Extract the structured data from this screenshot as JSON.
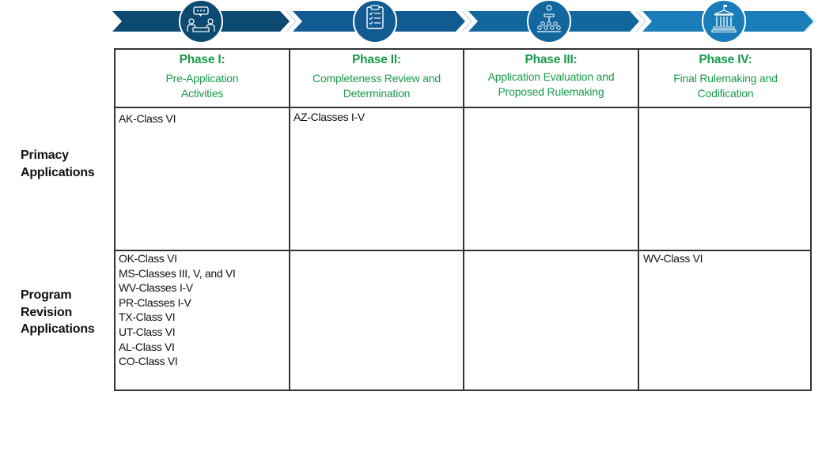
{
  "banner": {
    "colors": [
      "#0d4a72",
      "#115a92",
      "#13679f",
      "#1a7cb8"
    ],
    "icons": [
      "meeting-icon",
      "clipboard-checklist-icon",
      "presenter-audience-icon",
      "government-building-icon"
    ]
  },
  "phases": [
    {
      "label": "Phase I:",
      "description_lines": [
        "Pre-Application",
        "Activities"
      ]
    },
    {
      "label": "Phase II:",
      "description_lines": [
        "Completeness Review and",
        "Determination"
      ]
    },
    {
      "label": "Phase III:",
      "description_lines": [
        "Application Evaluation and",
        "Proposed Rulemaking"
      ]
    },
    {
      "label": "Phase IV:",
      "description_lines": [
        "Final Rulemaking and",
        "Codification"
      ]
    }
  ],
  "rows": [
    {
      "label_lines": [
        "Primacy",
        "Applications"
      ],
      "cells": [
        [
          "AK-Class VI"
        ],
        [
          "AZ-Classes I-V"
        ],
        [],
        []
      ]
    },
    {
      "label_lines": [
        "Program",
        "Revision",
        "Applications"
      ],
      "cells": [
        [
          "OK-Class VI",
          "MS-Classes III, V, and VI",
          "WV-Classes I-V",
          "PR-Classes I-V",
          "TX-Class VI",
          "UT-Class VI",
          "AL-Class VI",
          "CO-Class VI"
        ],
        [],
        [],
        [
          "WV-Class VI"
        ]
      ]
    }
  ],
  "colors": {
    "phase_text": "#1a9a4a",
    "grid": "#333333"
  }
}
